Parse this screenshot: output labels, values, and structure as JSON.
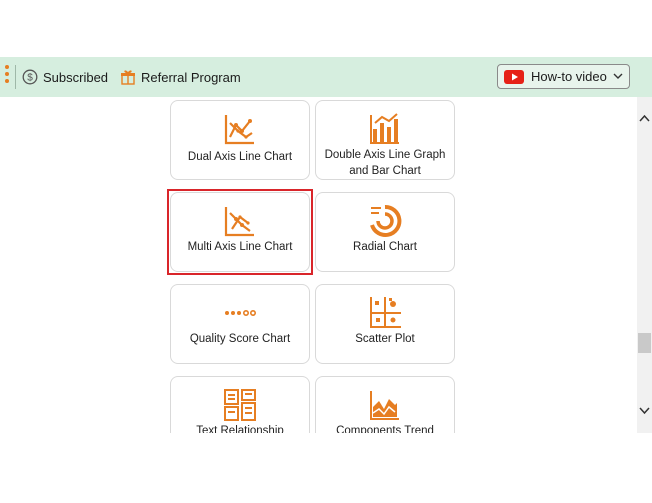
{
  "toolbar": {
    "subscribed_label": "Subscribed",
    "referral_label": "Referral Program",
    "howto_label": "How-to video"
  },
  "charts": [
    {
      "label": "Dual Axis Line Chart",
      "icon": "dual-axis-line-chart-icon"
    },
    {
      "label": "Double Axis Line Graph and Bar Chart",
      "icon": "double-axis-line-bar-icon"
    },
    {
      "label": "Multi Axis Line Chart",
      "icon": "multi-axis-line-chart-icon"
    },
    {
      "label": "Radial Chart",
      "icon": "radial-chart-icon"
    },
    {
      "label": "Quality Score Chart",
      "icon": "quality-score-chart-icon"
    },
    {
      "label": "Scatter Plot",
      "icon": "scatter-plot-icon"
    },
    {
      "label": "Text Relationship",
      "icon": "text-relationship-icon"
    },
    {
      "label": "Components Trend",
      "icon": "components-trend-icon"
    }
  ],
  "colors": {
    "accent": "#e67e22",
    "toolbar_bg": "#d6eedf",
    "selected_border": "#d9252a",
    "youtube_red": "#e62117"
  }
}
